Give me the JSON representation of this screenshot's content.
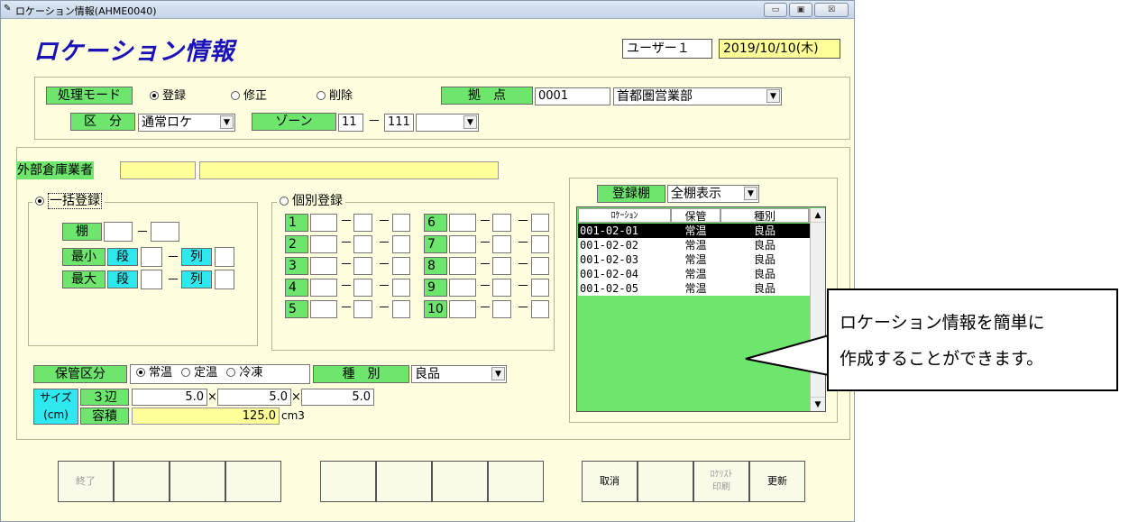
{
  "window": {
    "title": "ロケーション情報(AHME0040)",
    "controls": {
      "minimize": "▭",
      "maximize": "▣",
      "close": "☒"
    }
  },
  "header": {
    "app_title": "ロケーション情報",
    "user": "ユーザー１",
    "date": "2019/10/10(木)"
  },
  "top_panel": {
    "mode_label": "処理モード",
    "modes": [
      "登録",
      "修正",
      "削除"
    ],
    "selected_mode": "登録",
    "base_label": "拠　点",
    "base_code": "0001",
    "base_name": "首都圏営業部",
    "kubun_label": "区　分",
    "kubun_value": "通常ロケ",
    "zone_label": "ゾーン",
    "zone_from": "11",
    "zone_dash": "－",
    "zone_to": "111"
  },
  "main_panel": {
    "ext_warehouse_label": "外部倉庫業者",
    "bulk": {
      "caption": "一括登録",
      "shelf_label": "棚",
      "min_label": "最小",
      "max_label": "最大",
      "dan_label": "段",
      "retsu_label": "列",
      "dash": "－"
    },
    "individual": {
      "caption": "個別登録",
      "rows": [
        "1",
        "2",
        "3",
        "4",
        "5",
        "6",
        "7",
        "8",
        "9",
        "10"
      ],
      "dash": "－"
    },
    "storage": {
      "label": "保管区分",
      "options": [
        "常温",
        "定温",
        "冷凍"
      ],
      "selected": "常温",
      "type_label": "種　別",
      "type_value": "良品"
    },
    "size": {
      "size_label": "サイズ",
      "cm_label": "(cm)",
      "three_sides_label": "３辺",
      "volume_label": "容積",
      "w": "5.0",
      "d": "5.0",
      "h": "5.0",
      "times": "×",
      "volume": "125.0",
      "volume_unit": "cm3"
    }
  },
  "shelf_list": {
    "label": "登録棚",
    "filter": "全棚表示",
    "columns": [
      "ﾛｹｰｼｮﾝ",
      "保管",
      "種別"
    ],
    "rows": [
      [
        "001-02-01",
        "常温",
        "良品"
      ],
      [
        "001-02-02",
        "常温",
        "良品"
      ],
      [
        "001-02-03",
        "常温",
        "良品"
      ],
      [
        "001-02-04",
        "常温",
        "良品"
      ],
      [
        "001-02-05",
        "常温",
        "良品"
      ]
    ]
  },
  "callout": {
    "line1": "ロケーション情報を簡単に",
    "line2": "作成することができます。"
  },
  "footer": {
    "end": "終了",
    "cancel": "取消",
    "print_line1": "ﾛｹﾘｽﾄ",
    "print_line2": "印刷",
    "update": "更新"
  },
  "colors": {
    "title_blue": "#1a14b8",
    "label_green": "#6ee66e",
    "label_cyan": "#2ee8f0",
    "background": "#ffffe0",
    "highlight_yellow": "#ffff99"
  }
}
